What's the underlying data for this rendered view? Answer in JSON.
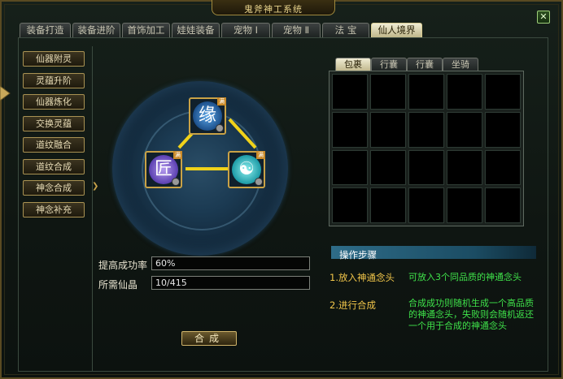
{
  "window": {
    "title": "鬼斧神工系统",
    "close_label": "✕"
  },
  "tabs": [
    {
      "label": "装备打造",
      "active": false
    },
    {
      "label": "装备进阶",
      "active": false
    },
    {
      "label": "首饰加工",
      "active": false
    },
    {
      "label": "娃娃装备",
      "active": false
    },
    {
      "label": "宠物 Ⅰ",
      "active": false
    },
    {
      "label": "宠物 Ⅱ",
      "active": false
    },
    {
      "label": "法 宝",
      "active": false
    },
    {
      "label": "仙人境界",
      "active": true
    }
  ],
  "sidebar": {
    "items": [
      {
        "label": "仙器附灵"
      },
      {
        "label": "灵蕴升阶"
      },
      {
        "label": "仙器炼化"
      },
      {
        "label": "交换灵蕴"
      },
      {
        "label": "道纹融合"
      },
      {
        "label": "道纹合成"
      },
      {
        "label": "神念合成"
      },
      {
        "label": "神念补充"
      }
    ]
  },
  "compose": {
    "slots": [
      {
        "glyph": "缘",
        "corner": "满"
      },
      {
        "glyph": "匠",
        "corner": "满"
      },
      {
        "glyph": "☯",
        "corner": "满"
      }
    ],
    "success_rate": {
      "label": "提高成功率",
      "value": "60%"
    },
    "crystal": {
      "label": "所需仙晶",
      "value": "10/415"
    },
    "button_label": "合成"
  },
  "bag": {
    "tabs": [
      {
        "label": "包裹",
        "active": true
      },
      {
        "label": "行囊",
        "active": false
      },
      {
        "label": "行囊",
        "active": false
      },
      {
        "label": "坐骑",
        "active": false
      }
    ],
    "rows": 4,
    "cols": 5
  },
  "steps": {
    "title": "操作步骤",
    "items": [
      {
        "label": "1.放入神通念头",
        "desc": "可放入3个同品质的神通念头"
      },
      {
        "label": "2.进行合成",
        "desc": "合成成功则随机生成一个高品质的神通念头，失败则会随机返还一个用于合成的神通念头"
      }
    ]
  },
  "colors": {
    "accent_gold": "#c9a246",
    "step_green": "#3fe24a",
    "step_yellow": "#f2c64a"
  }
}
